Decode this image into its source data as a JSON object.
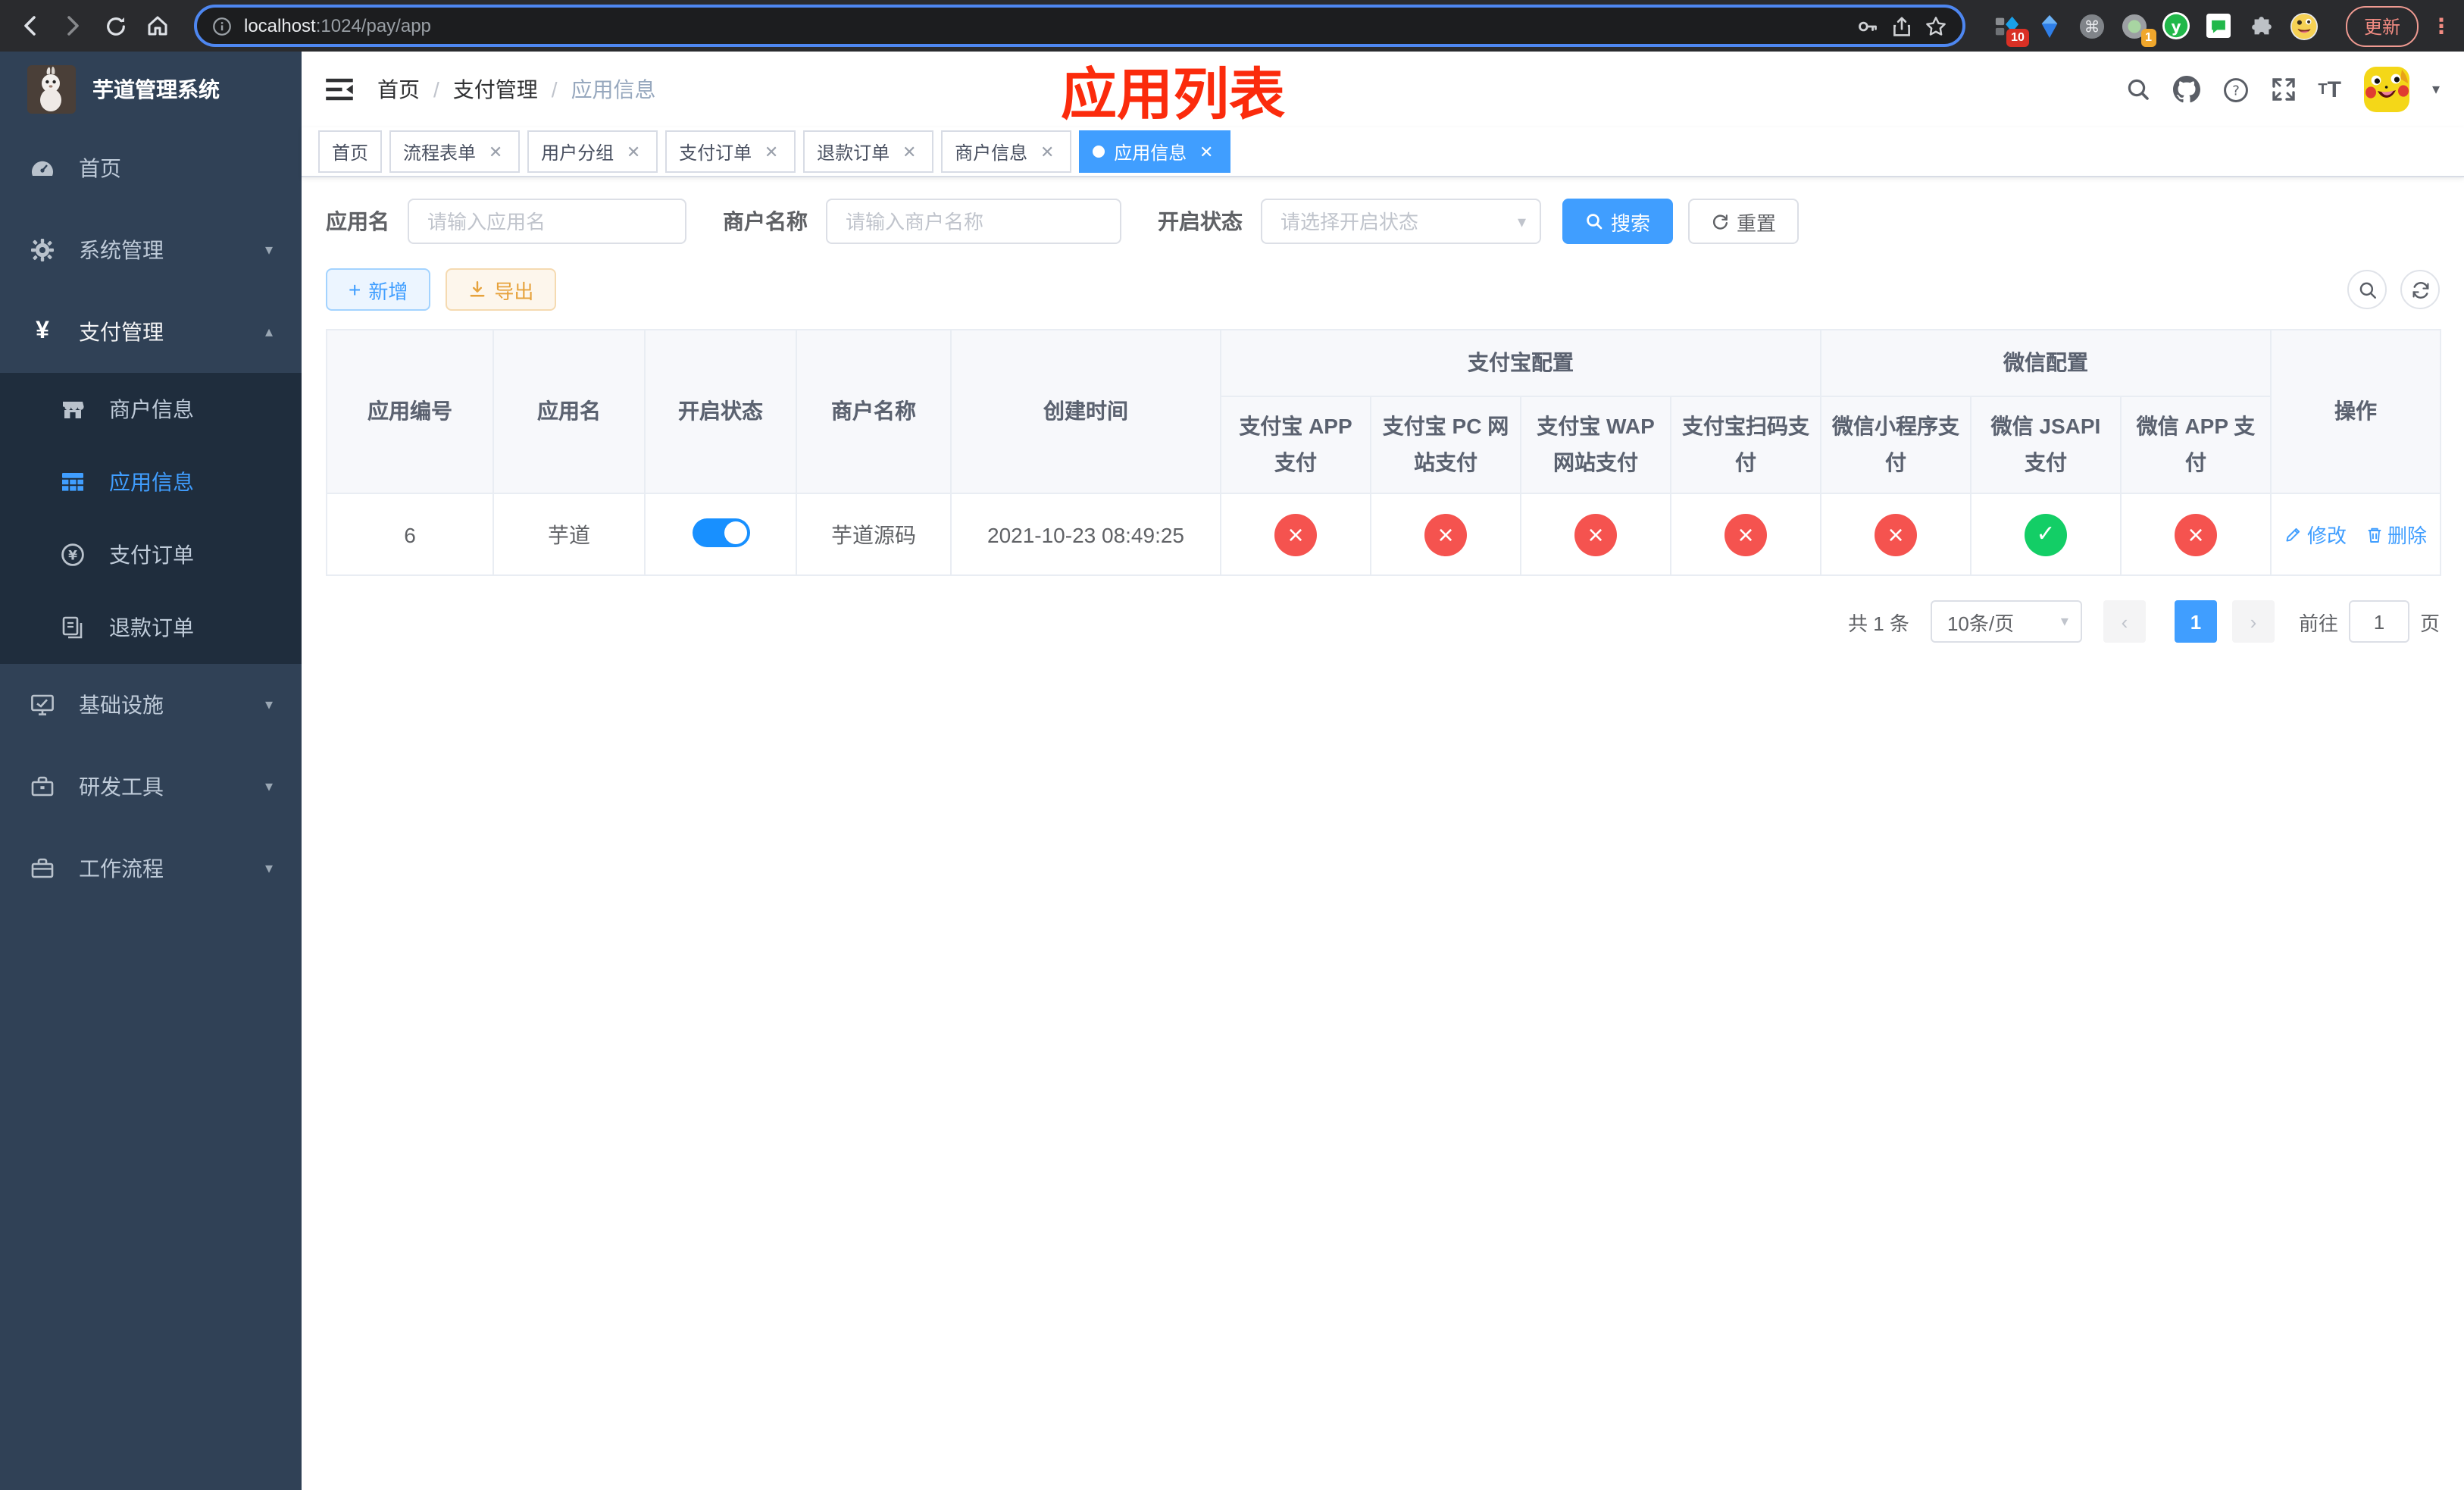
{
  "colors": {
    "accent": "#409EFF",
    "success": "#13ce66",
    "danger": "#f5534f",
    "warning": "#e6a23c",
    "title_red": "#fb2b0c",
    "sidebar_bg": "#304156",
    "submenu_bg": "#1f2d3d"
  },
  "browser": {
    "url_host": "localhost",
    "url_rest": ":1024/pay/app",
    "ext_badge_count": "10",
    "ext_badge_one": "1",
    "update_label": "更新"
  },
  "sidebar": {
    "logo_title": "芋道管理系统",
    "items": [
      {
        "label": "首页"
      },
      {
        "label": "系统管理"
      },
      {
        "label": "支付管理"
      },
      {
        "label": "商户信息"
      },
      {
        "label": "应用信息"
      },
      {
        "label": "支付订单"
      },
      {
        "label": "退款订单"
      },
      {
        "label": "基础设施"
      },
      {
        "label": "研发工具"
      },
      {
        "label": "工作流程"
      }
    ]
  },
  "header": {
    "breadcrumb": [
      "首页",
      "支付管理",
      "应用信息"
    ],
    "overlay_title": "应用列表"
  },
  "tabs": [
    {
      "label": "首页"
    },
    {
      "label": "流程表单"
    },
    {
      "label": "用户分组"
    },
    {
      "label": "支付订单"
    },
    {
      "label": "退款订单"
    },
    {
      "label": "商户信息"
    },
    {
      "label": "应用信息"
    }
  ],
  "filters": {
    "app_name_label": "应用名",
    "app_name_placeholder": "请输入应用名",
    "merchant_label": "商户名称",
    "merchant_placeholder": "请输入商户名称",
    "status_label": "开启状态",
    "status_placeholder": "请选择开启状态",
    "search_label": "搜索",
    "reset_label": "重置"
  },
  "toolbar": {
    "add_label": "新增",
    "export_label": "导出"
  },
  "table": {
    "headers": {
      "app_id": "应用编号",
      "app_name": "应用名",
      "status": "开启状态",
      "merchant": "商户名称",
      "created": "创建时间",
      "alipay_group": "支付宝配置",
      "wechat_group": "微信配置",
      "operation": "操作",
      "alipay_app": "支付宝 APP 支付",
      "alipay_pc": "支付宝 PC 网站支付",
      "alipay_wap": "支付宝 WAP 网站支付",
      "alipay_qr": "支付宝扫码支付",
      "wx_lite": "微信小程序支付",
      "wx_jsapi": "微信 JSAPI 支付",
      "wx_app": "微信 APP 支付"
    },
    "row": {
      "id": "6",
      "name": "芋道",
      "switch_state": "on",
      "merchant": "芋道源码",
      "created": "2021-10-23 08:49:25",
      "channels": [
        "fail",
        "fail",
        "fail",
        "fail",
        "fail",
        "success",
        "fail"
      ],
      "edit_label": "修改",
      "delete_label": "删除"
    }
  },
  "pagination": {
    "total": "共 1 条",
    "page_size": "10条/页",
    "current_page": "1",
    "goto_prefix": "前往",
    "goto_value": "1",
    "goto_suffix": "页"
  }
}
